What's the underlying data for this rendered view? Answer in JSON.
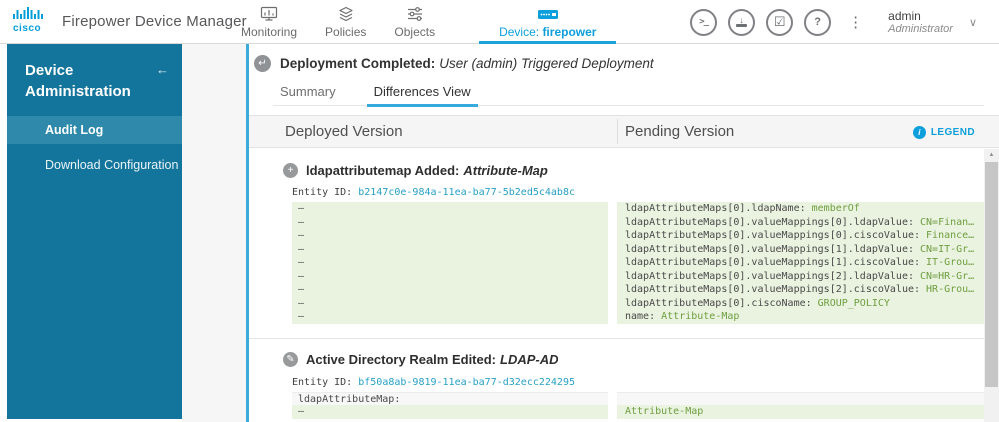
{
  "header": {
    "logo_text": "cisco",
    "brand": "Firepower Device Manager",
    "nav": [
      {
        "label": "Monitoring"
      },
      {
        "label": "Policies"
      },
      {
        "label": "Objects"
      },
      {
        "label_prefix": "Device: ",
        "device_name": "firepower",
        "active": true
      }
    ],
    "user": {
      "name": "admin",
      "role": "Administrator"
    },
    "action_icons": [
      "cli-console-icon",
      "deploy-icon",
      "tasks-icon",
      "help-icon",
      "more-options-icon"
    ]
  },
  "sidebar": {
    "title": "Device Administration",
    "back_icon": "←",
    "items": [
      {
        "label": "Audit Log",
        "selected": true
      },
      {
        "label": "Download Configuration",
        "selected": false
      }
    ]
  },
  "main": {
    "event_title_bold": "Deployment Completed:",
    "event_title_italic": "User (admin) Triggered Deployment",
    "tabs": [
      {
        "label": "Summary",
        "active": false
      },
      {
        "label": "Differences View",
        "active": true
      }
    ],
    "columns": {
      "left": "Deployed Version",
      "right": "Pending Version"
    },
    "legend_label": "LEGEND",
    "sections": [
      {
        "icon": "added",
        "title_bold": "ldapattributemap Added:",
        "title_italic": "Attribute-Map",
        "entity_label": "Entity ID:",
        "entity_id": "b2147c0e-984a-11ea-ba77-5b2ed5c4ab8c",
        "rows": [
          {
            "left": {
              "text": "–",
              "added": true
            },
            "right": {
              "key": "ldapAttributeMaps[0].ldapName:",
              "value": "memberOf",
              "added": true
            }
          },
          {
            "left": {
              "text": "–",
              "added": true
            },
            "right": {
              "key": "ldapAttributeMaps[0].valueMappings[0].ldapValue:",
              "value": "CN=Finan…",
              "added": true
            }
          },
          {
            "left": {
              "text": "–",
              "added": true
            },
            "right": {
              "key": "ldapAttributeMaps[0].valueMappings[0].ciscoValue:",
              "value": "Finance…",
              "added": true
            }
          },
          {
            "left": {
              "text": "–",
              "added": true
            },
            "right": {
              "key": "ldapAttributeMaps[0].valueMappings[1].ldapValue:",
              "value": "CN=IT-Gr…",
              "added": true
            }
          },
          {
            "left": {
              "text": "–",
              "added": true
            },
            "right": {
              "key": "ldapAttributeMaps[0].valueMappings[1].ciscoValue:",
              "value": "IT-Grou…",
              "added": true
            }
          },
          {
            "left": {
              "text": "–",
              "added": true
            },
            "right": {
              "key": "ldapAttributeMaps[0].valueMappings[2].ldapValue:",
              "value": "CN=HR-Gr…",
              "added": true
            }
          },
          {
            "left": {
              "text": "–",
              "added": true
            },
            "right": {
              "key": "ldapAttributeMaps[0].valueMappings[2].ciscoValue:",
              "value": "HR-Grou…",
              "added": true
            }
          },
          {
            "left": {
              "text": "–",
              "added": true
            },
            "right": {
              "key": "ldapAttributeMaps[0].ciscoName:",
              "value": "GROUP_POLICY",
              "added": true
            }
          },
          {
            "left": {
              "text": "–",
              "added": true
            },
            "right": {
              "key": "name:",
              "value": "Attribute-Map",
              "added": true
            }
          }
        ]
      },
      {
        "icon": "edited",
        "title_bold": "Active Directory Realm Edited:",
        "title_italic": "LDAP-AD",
        "entity_label": "Entity ID:",
        "entity_id": "bf50a8ab-9819-11ea-ba77-d32ecc224295",
        "rows": [
          {
            "left": {
              "key": "ldapAttributeMap:",
              "added": false,
              "plain": true
            },
            "right": {
              "added": false,
              "plain": true
            }
          },
          {
            "left": {
              "text": "–",
              "added": true
            },
            "right": {
              "value": "Attribute-Map",
              "added": true
            }
          }
        ]
      }
    ]
  },
  "colors": {
    "accent_blue": "#0d9fdb",
    "sidebar_teal": "#13749c",
    "sidebar_selected": "#2e89ab",
    "panel_edge_blue": "#3dabd8",
    "diff_added_bg": "#e9f3e0",
    "diff_value_green": "#6f9e3f",
    "entity_link": "#27a0c5",
    "cisco_logo_blue": "#049fd9"
  }
}
